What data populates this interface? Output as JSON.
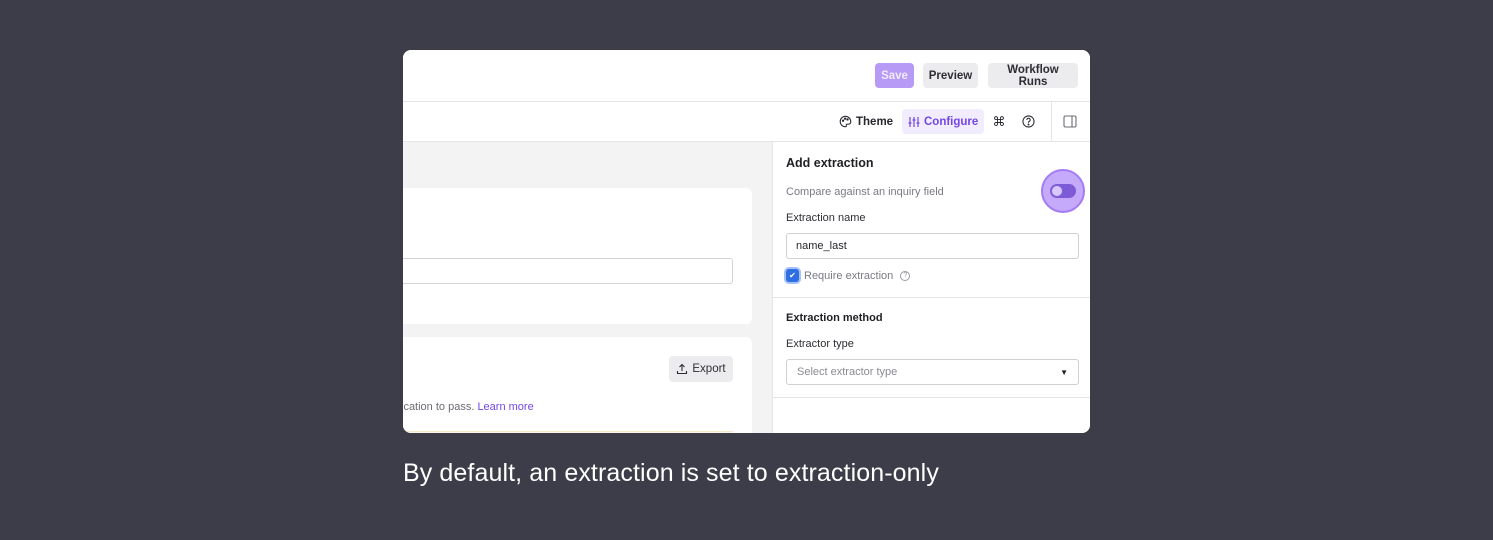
{
  "topbar": {
    "save_label": "Save",
    "preview_label": "Preview",
    "workflow_runs_label": "Workflow Runs"
  },
  "toolbar": {
    "theme_label": "Theme",
    "configure_label": "Configure",
    "command_icon": "⌘",
    "help_icon": "?"
  },
  "main": {
    "export_label": "Export",
    "description_fragment": "ication to pass. ",
    "learn_more_label": "Learn more"
  },
  "panel": {
    "title": "Add extraction",
    "compare_label": "Compare against an inquiry field",
    "compare_toggle_on": false,
    "extraction_name_label": "Extraction name",
    "extraction_name_value": "name_last",
    "require_extraction_label": "Require extraction",
    "require_extraction_checked": true,
    "method_title": "Extraction method",
    "extractor_type_label": "Extractor type",
    "extractor_type_placeholder": "Select extractor type"
  },
  "caption": "By default, an extraction is set to extraction-only",
  "colors": {
    "accent": "#7446e6",
    "save_bg": "#b69af5",
    "checkbox": "#2f6fe4",
    "backdrop": "#3c3d48"
  }
}
